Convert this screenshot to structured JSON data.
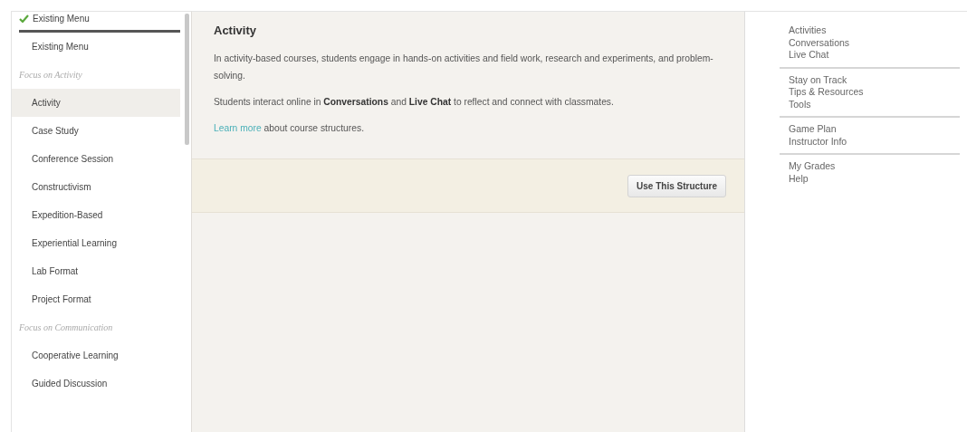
{
  "menu_select": {
    "label": "Existing Menu",
    "checked": true
  },
  "sidebar": {
    "items": [
      {
        "kind": "item",
        "label": "Existing Menu",
        "selected": false
      },
      {
        "kind": "heading",
        "label": "Focus on Activity"
      },
      {
        "kind": "item",
        "label": "Activity",
        "selected": true
      },
      {
        "kind": "item",
        "label": "Case Study",
        "selected": false
      },
      {
        "kind": "item",
        "label": "Conference Session",
        "selected": false
      },
      {
        "kind": "item",
        "label": "Constructivism",
        "selected": false
      },
      {
        "kind": "item",
        "label": "Expedition-Based",
        "selected": false
      },
      {
        "kind": "item",
        "label": "Experiential Learning",
        "selected": false
      },
      {
        "kind": "item",
        "label": "Lab Format",
        "selected": false
      },
      {
        "kind": "item",
        "label": "Project Format",
        "selected": false
      },
      {
        "kind": "heading",
        "label": "Focus on Communication"
      },
      {
        "kind": "item",
        "label": "Cooperative Learning",
        "selected": false
      },
      {
        "kind": "item",
        "label": "Guided Discussion",
        "selected": false
      }
    ]
  },
  "detail": {
    "title": "Activity",
    "paragraphs": [
      "In activity-based courses, students engage in hands-on activities and field work, research and experiments, and problem-solving.",
      "Students interact online in **Conversations** and **Live Chat** to reflect and connect with classmates."
    ],
    "link": "Learn more",
    "link_suffix": "about course structures.",
    "button": "Use This Structure"
  },
  "preview_menu": [
    [
      "Activities",
      "Conversations",
      "Live Chat"
    ],
    [
      "Stay on Track",
      "Tips & Resources",
      "Tools"
    ],
    [
      "Game Plan",
      "Instructor Info"
    ],
    [
      "My Grades",
      "Help"
    ]
  ]
}
